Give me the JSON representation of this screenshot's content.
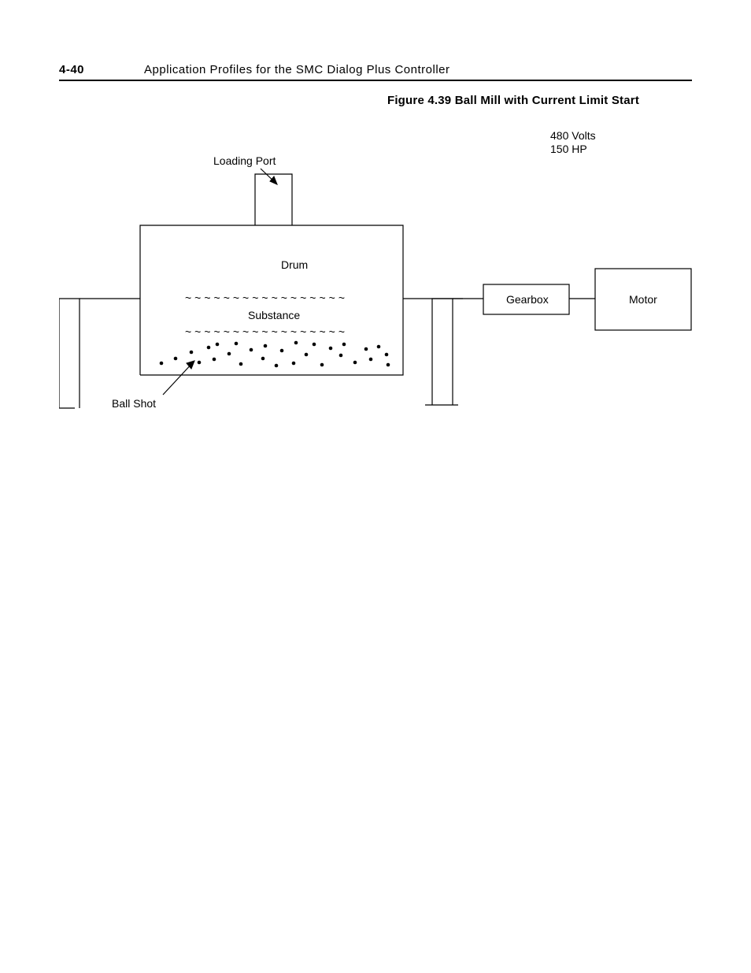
{
  "header": {
    "page_number": "4-40",
    "section_title": "Application Profiles for the SMC Dialog Plus Controller"
  },
  "figure": {
    "title": "Figure 4.39 Ball Mill with Current Limit Start",
    "labels": {
      "loading_port": "Loading Port",
      "drum": "Drum",
      "substance": "Substance",
      "ball_shot": "Ball Shot",
      "gearbox": "Gearbox",
      "motor": "Motor"
    },
    "specs": {
      "voltage": "480 Volts",
      "power": "150 HP"
    }
  }
}
